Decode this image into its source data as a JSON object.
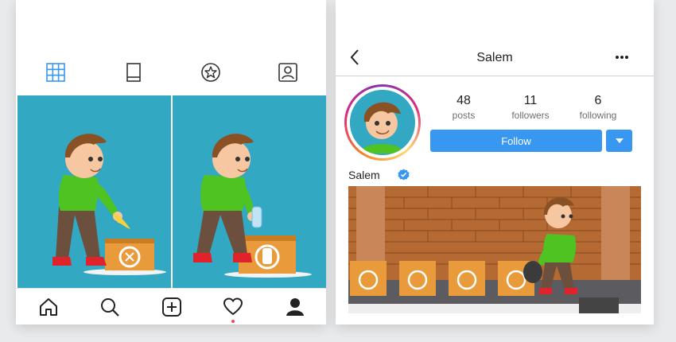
{
  "colors": {
    "accent": "#3897f0",
    "tile_bg": "#33a8c3",
    "box": "#e99a3b",
    "notification": "#ed4956"
  },
  "left_phone": {
    "tabs": [
      {
        "icon": "grid-icon",
        "active": true
      },
      {
        "icon": "feed-icon",
        "active": false
      },
      {
        "icon": "star-icon",
        "active": false
      },
      {
        "icon": "tagged-icon",
        "active": false
      }
    ],
    "posts": [
      {
        "image": "boy-recycling-banana-peel"
      },
      {
        "image": "boy-recycling-plastic-bottle"
      }
    ],
    "bottom_nav": [
      {
        "icon": "home-icon"
      },
      {
        "icon": "search-icon"
      },
      {
        "icon": "add-icon"
      },
      {
        "icon": "heart-icon"
      },
      {
        "icon": "profile-icon"
      }
    ]
  },
  "profile": {
    "title": "Salem",
    "username": "Salem",
    "verified": true,
    "stats": {
      "posts": {
        "count": "48",
        "label": "posts"
      },
      "followers": {
        "count": "11",
        "label": "followers"
      },
      "following": {
        "count": "6",
        "label": "following"
      }
    },
    "follow_label": "Follow",
    "post_image": "boy-sorting-trash-into-recycling-bins"
  }
}
